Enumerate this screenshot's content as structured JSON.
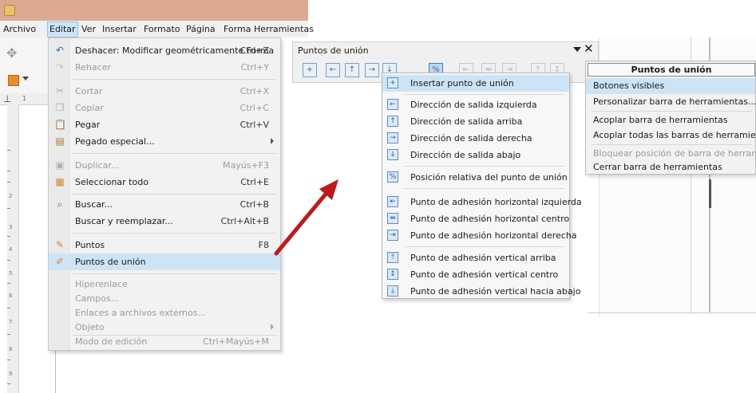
{
  "menubar": {
    "items": [
      "Archivo",
      "Editar",
      "Ver",
      "Insertar",
      "Formato",
      "Página",
      "Forma",
      "Herramientas"
    ]
  },
  "edit_menu": {
    "items": [
      {
        "label": "Deshacer: Modificar geométricamente Forma",
        "shortcut": "Ctrl+Z",
        "icon": "undo-icon",
        "enabled": true
      },
      {
        "label": "Rehacer",
        "shortcut": "Ctrl+Y",
        "icon": "redo-icon",
        "enabled": false
      },
      {
        "label": "Cortar",
        "shortcut": "Ctrl+X",
        "icon": "cut-icon",
        "enabled": false
      },
      {
        "label": "Copiar",
        "shortcut": "Ctrl+C",
        "icon": "copy-icon",
        "enabled": false
      },
      {
        "label": "Pegar",
        "shortcut": "Ctrl+V",
        "icon": "paste-icon",
        "enabled": true
      },
      {
        "label": "Pegado especial...",
        "shortcut": "",
        "icon": "paste-special-icon",
        "enabled": true,
        "submenu": true
      },
      {
        "label": "Duplicar...",
        "shortcut": "Mayús+F3",
        "icon": "duplicate-icon",
        "enabled": false
      },
      {
        "label": "Seleccionar todo",
        "shortcut": "Ctrl+E",
        "icon": "select-all-icon",
        "enabled": true
      },
      {
        "label": "Buscar...",
        "shortcut": "Ctrl+B",
        "icon": "search-icon",
        "enabled": true
      },
      {
        "label": "Buscar y reemplazar...",
        "shortcut": "Ctrl+Alt+B",
        "icon": "",
        "enabled": true
      },
      {
        "label": "Puntos",
        "shortcut": "F8",
        "icon": "points-icon",
        "enabled": true
      },
      {
        "label": "Puntos de unión",
        "shortcut": "",
        "icon": "glue-points-icon",
        "enabled": true,
        "highlighted": true
      },
      {
        "label": "Hiperenlace",
        "shortcut": "",
        "icon": "",
        "enabled": false
      },
      {
        "label": "Campos...",
        "shortcut": "",
        "icon": "",
        "enabled": false
      },
      {
        "label": "Enlaces a archivos externos...",
        "shortcut": "",
        "icon": "",
        "enabled": false
      },
      {
        "label": "Objeto",
        "shortcut": "",
        "icon": "",
        "enabled": false,
        "submenu": true
      },
      {
        "label": "Modo de edición",
        "shortcut": "Ctrl+Mayús+M",
        "icon": "",
        "enabled": false
      }
    ]
  },
  "glue_toolbar": {
    "title": "Puntos de unión",
    "close_glyph": "✕"
  },
  "visible_buttons": {
    "items": [
      "Insertar punto de unión",
      "Dirección de salida izquierda",
      "Dirección de salida arriba",
      "Dirección de salida derecha",
      "Dirección de salida abajo",
      "Posición relativa del punto de unión",
      "Punto de adhesión horizontal izquierda",
      "Punto de adhesión horizontal centro",
      "Punto de adhesión horizontal derecha",
      "Punto de adhesión vertical arriba",
      "Punto de adhesión vertical centro",
      "Punto de adhesión vertical hacia abajo"
    ]
  },
  "context_menu": {
    "title": "Puntos de unión",
    "items": [
      {
        "label": "Botones visibles",
        "highlighted": true,
        "enabled": true
      },
      {
        "label": "Personalizar barra de herramientas...",
        "enabled": true
      },
      {
        "label": "Acoplar barra de herramientas",
        "enabled": true
      },
      {
        "label": "Acoplar todas las barras de herramientas",
        "enabled": true
      },
      {
        "label": "Bloquear posición de barra de herramientas",
        "enabled": false
      },
      {
        "label": "Cerrar barra de herramientas",
        "enabled": true
      }
    ]
  },
  "rulers": {
    "h_label": "1",
    "v_labels": [
      "2",
      "3",
      "4",
      "5",
      "6",
      "7",
      "8",
      "9"
    ]
  },
  "colors": {
    "titlebar": "#dcaa90",
    "highlight": "#cde4f7",
    "arrow": "#c0181e"
  }
}
